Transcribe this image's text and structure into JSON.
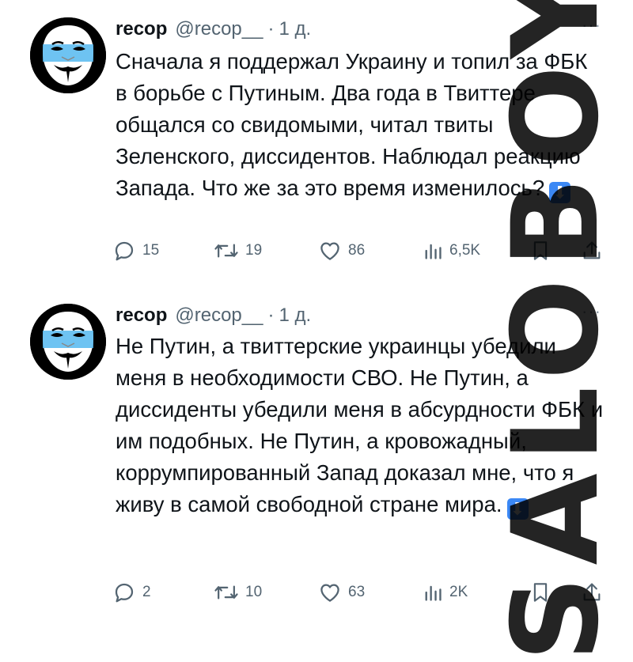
{
  "tweets": [
    {
      "author": {
        "name": "recop",
        "handle": "@recop__",
        "time": "1 д."
      },
      "separator": "·",
      "text": "Сначала я поддержал Украину и топил за ФБК в борьбе с Путиным. Два года в Твиттере общался со свидомыми, читал твиты Зеленского, диссидентов. Наблюдал реакцию Запада. Что же за это время изменилось?",
      "emoji": "⬇",
      "stats": {
        "replies": "15",
        "retweets": "19",
        "likes": "86",
        "views": "6,5K"
      }
    },
    {
      "author": {
        "name": "recop",
        "handle": "@recop__",
        "time": "1 д."
      },
      "separator": "·",
      "text": "Не Путин, а твиттерские украинцы убедили меня в необходимости СВО. Не Путин, а диссиденты убедили меня в абсурдности ФБК и им подобных. Не Путин, а кровожадный, коррумпированный Запад доказал мне, что я живу в самой свободной стране мира.",
      "emoji": "⬇",
      "stats": {
        "replies": "2",
        "retweets": "10",
        "likes": "63",
        "views": "2K"
      }
    }
  ],
  "more_menu": "···",
  "icons": [
    "avatar-mask-icon",
    "reply-icon",
    "retweet-icon",
    "like-icon",
    "views-icon",
    "bookmark-icon",
    "share-icon"
  ],
  "watermark": "SALOBOY",
  "colors": {
    "text": "#0f1419",
    "secondary": "#536471",
    "emoji_bg": "#3b88f5"
  }
}
